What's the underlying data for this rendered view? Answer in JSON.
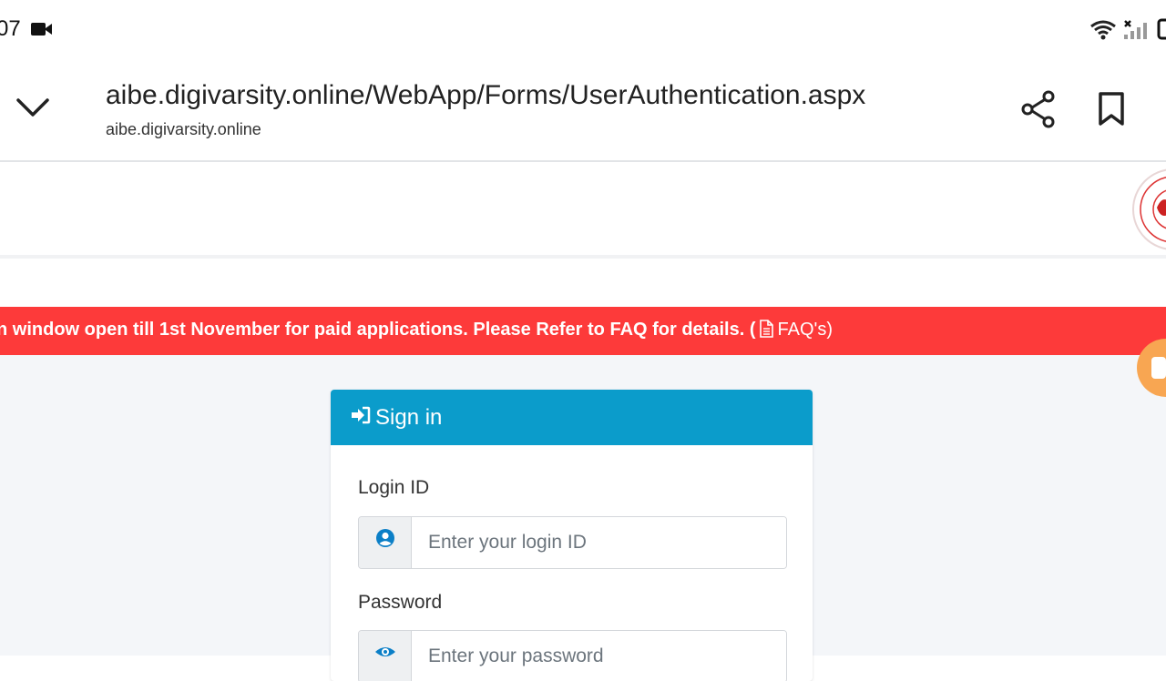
{
  "status_bar": {
    "time": "07",
    "icons": [
      "video-icon",
      "wifi-icon",
      "signal-icon",
      "battery-icon"
    ]
  },
  "browser": {
    "url": "aibe.digivarsity.online/WebApp/Forms/UserAuthentication.aspx",
    "domain": "aibe.digivarsity.online",
    "icons": [
      "chevron-down-icon",
      "share-icon",
      "bookmark-icon"
    ]
  },
  "notice": {
    "text": "n window open till 1st November for paid applications. Please Refer to FAQ for details. (",
    "link_label": "FAQ's)",
    "background": "#fd3a3a"
  },
  "signin": {
    "title": "Sign in",
    "header_color": "#0b9ccb",
    "login_label": "Login ID",
    "login_placeholder": "Enter your login ID",
    "password_label": "Password",
    "password_placeholder": "Enter your password"
  }
}
